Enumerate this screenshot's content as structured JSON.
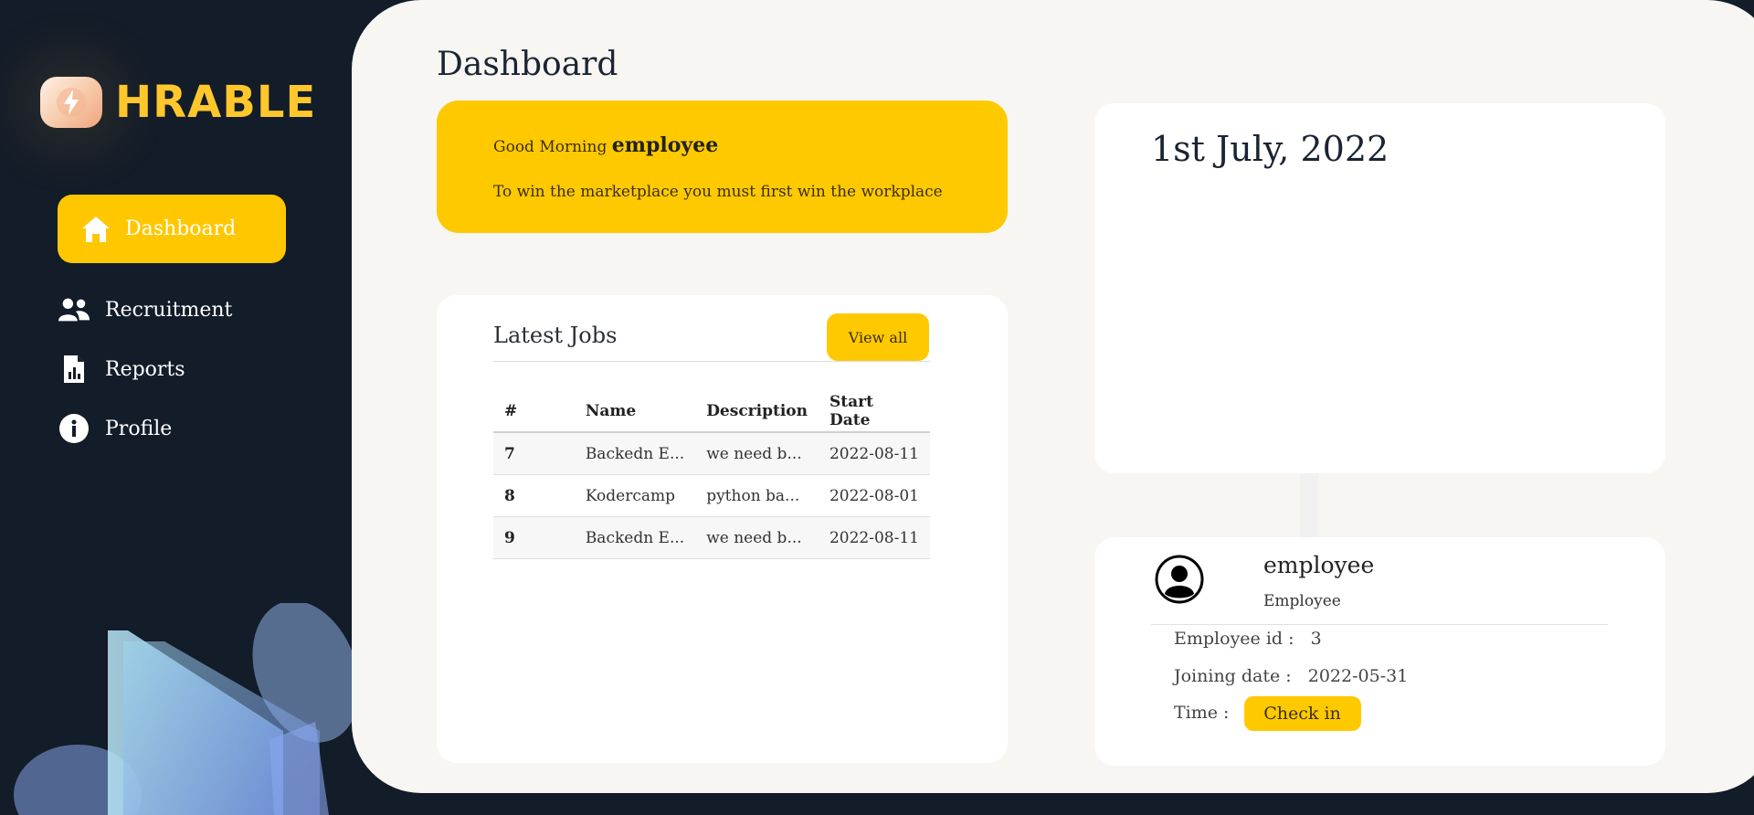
{
  "brand": {
    "name": "HRABLE"
  },
  "sidebar": {
    "items": [
      {
        "label": "Dashboard",
        "icon": "home-icon",
        "active": true
      },
      {
        "label": "Recruitment",
        "icon": "users-icon"
      },
      {
        "label": "Reports",
        "icon": "report-icon"
      },
      {
        "label": "Profile",
        "icon": "info-icon"
      }
    ]
  },
  "main": {
    "title": "Dashboard",
    "greeting": {
      "prefix": "Good Morning",
      "name": "employee",
      "quote": "To win the marketplace you must first win the workplace"
    },
    "jobs": {
      "title": "Latest Jobs",
      "view_all": "View all",
      "columns": [
        "#",
        "Name",
        "Description",
        "Start Date"
      ],
      "rows": [
        {
          "id": "7",
          "name": "Backedn E...",
          "description": "we need b...",
          "start": "2022-08-11"
        },
        {
          "id": "8",
          "name": "Kodercamp",
          "description": "python ba...",
          "start": "2022-08-01"
        },
        {
          "id": "9",
          "name": "Backedn E...",
          "description": "we need b...",
          "start": "2022-08-11"
        }
      ]
    },
    "date": "1st July, 2022",
    "profile": {
      "name": "employee",
      "role": "Employee",
      "employee_id_label": "Employee id :",
      "employee_id": "3",
      "joining_label": "Joining date :",
      "joining_date": "2022-05-31",
      "time_label": "Time :",
      "checkin_label": "Check in"
    }
  },
  "colors": {
    "accent": "#ffc900",
    "sidebar_bg": "#131c29",
    "panel_bg": "#f7f6f3"
  }
}
